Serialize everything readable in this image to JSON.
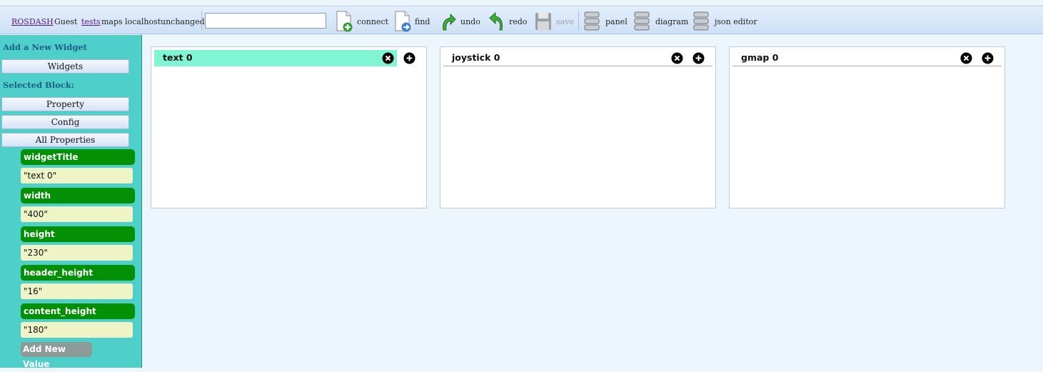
{
  "toolbar": {
    "brand": "ROSDASH",
    "user": "Guest",
    "project": "tests",
    "maps": "maps",
    "host": "localhost",
    "status": "unchanged",
    "search_value": "",
    "buttons": [
      {
        "label": "connect",
        "icon": "new-doc-plus-icon"
      },
      {
        "label": "find",
        "icon": "new-doc-arrow-icon"
      },
      {
        "label": "undo",
        "icon": "undo-arrow-icon"
      },
      {
        "label": "redo",
        "icon": "redo-arrow-icon"
      },
      {
        "label": "save",
        "icon": "floppy-disk-icon",
        "disabled": true
      },
      {
        "label": "panel",
        "icon": "server-stack-icon"
      },
      {
        "label": "diagram",
        "icon": "server-stack-icon"
      },
      {
        "label": "json editor",
        "icon": "server-stack-icon"
      }
    ]
  },
  "sidebar": {
    "add_heading": "Add a New Widget",
    "widgets_button": "Widgets",
    "selected_heading": "Selected Block:",
    "property_button": "Property",
    "config_button": "Config",
    "all_properties_button": "All Properties",
    "properties": [
      {
        "key": "widgetTitle",
        "value": "\"text 0\""
      },
      {
        "key": "width",
        "value": "\"400\""
      },
      {
        "key": "height",
        "value": "\"230\""
      },
      {
        "key": "header_height",
        "value": "\"16\""
      },
      {
        "key": "content_height",
        "value": "\"180\""
      }
    ],
    "add_new_value": "Add New Value"
  },
  "widgets": [
    {
      "title": "text 0",
      "active": true
    },
    {
      "title": "joystick 0",
      "active": false
    },
    {
      "title": "gmap 0",
      "active": false
    }
  ],
  "colors": {
    "sidebar_bg": "#4ecfc9",
    "prop_key_bg": "#049004",
    "prop_val_bg": "#eef4c6",
    "active_header_bg": "#7ff5d4",
    "workspace_bg": "#eef6fd"
  }
}
